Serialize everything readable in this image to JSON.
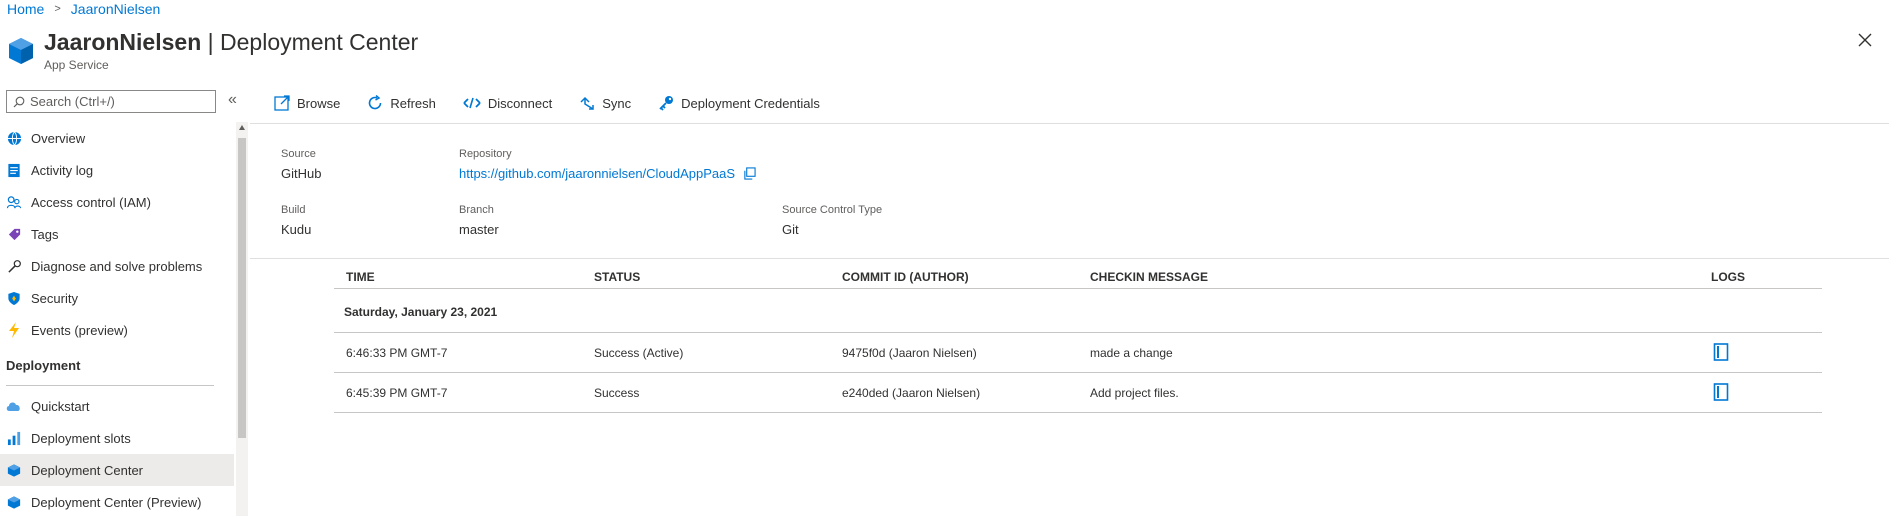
{
  "breadcrumb": {
    "home": "Home",
    "current": "JaaronNielsen"
  },
  "header": {
    "resource": "JaaronNielsen",
    "separator": " | ",
    "page": "Deployment Center",
    "subtitle": "App Service"
  },
  "search": {
    "placeholder": "Search (Ctrl+/)"
  },
  "sidebar": {
    "items": [
      {
        "label": "Overview",
        "icon": "globe-icon"
      },
      {
        "label": "Activity log",
        "icon": "activity-log-icon"
      },
      {
        "label": "Access control (IAM)",
        "icon": "people-icon"
      },
      {
        "label": "Tags",
        "icon": "tag-icon"
      },
      {
        "label": "Diagnose and solve problems",
        "icon": "wrench-icon"
      },
      {
        "label": "Security",
        "icon": "shield-icon"
      },
      {
        "label": "Events (preview)",
        "icon": "lightning-icon"
      }
    ],
    "section": "Deployment",
    "deployment_items": [
      {
        "label": "Quickstart",
        "icon": "cloud-icon"
      },
      {
        "label": "Deployment slots",
        "icon": "slots-icon"
      },
      {
        "label": "Deployment Center",
        "icon": "cube-icon",
        "active": true
      },
      {
        "label": "Deployment Center (Preview)",
        "icon": "cube-icon"
      }
    ]
  },
  "toolbar": {
    "browse": "Browse",
    "refresh": "Refresh",
    "disconnect": "Disconnect",
    "sync": "Sync",
    "credentials": "Deployment Credentials"
  },
  "info": {
    "source_label": "Source",
    "source": "GitHub",
    "repo_label": "Repository",
    "repo": "https://github.com/jaaronnielsen/CloudAppPaaS",
    "build_label": "Build",
    "build": "Kudu",
    "branch_label": "Branch",
    "branch": "master",
    "sct_label": "Source Control Type",
    "sct": "Git"
  },
  "table": {
    "headers": {
      "time": "TIME",
      "status": "STATUS",
      "commit": "COMMIT ID (AUTHOR)",
      "message": "CHECKIN MESSAGE",
      "logs": "LOGS"
    },
    "group": "Saturday, January 23, 2021",
    "rows": [
      {
        "time": "6:46:33 PM GMT-7",
        "status": "Success (Active)",
        "commit": "9475f0d (Jaaron Nielsen)",
        "message": "made a change"
      },
      {
        "time": "6:45:39 PM GMT-7",
        "status": "Success",
        "commit": "e240ded (Jaaron Nielsen)",
        "message": "Add project files."
      }
    ]
  },
  "colors": {
    "accent": "#0078d4",
    "active_bg": "#edebe9"
  }
}
